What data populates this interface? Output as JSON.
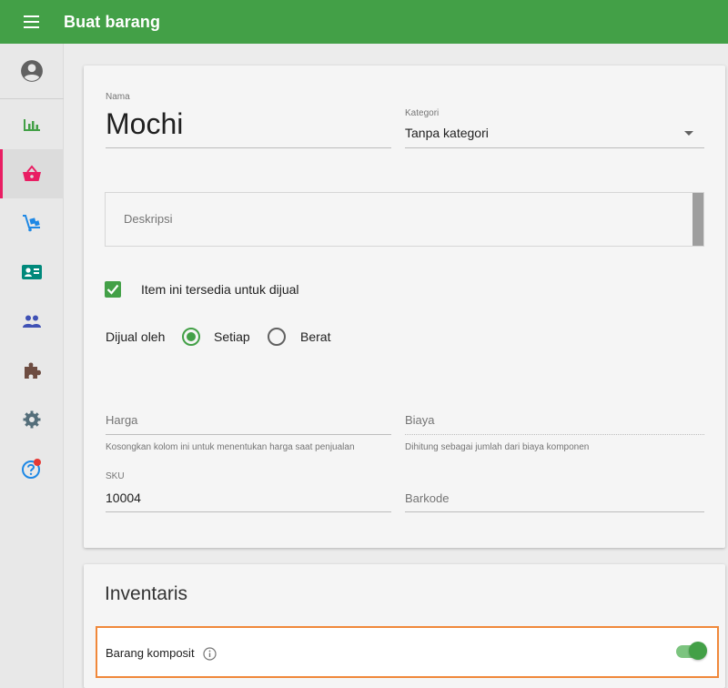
{
  "header": {
    "title": "Buat barang"
  },
  "sidebar": {
    "items": [
      {
        "icon": "account-circle-icon"
      },
      {
        "icon": "bar-chart-icon"
      },
      {
        "icon": "basket-icon",
        "active": true
      },
      {
        "icon": "cart-dolly-icon"
      },
      {
        "icon": "id-card-icon"
      },
      {
        "icon": "people-icon"
      },
      {
        "icon": "puzzle-icon"
      },
      {
        "icon": "gear-icon"
      },
      {
        "icon": "help-icon"
      }
    ]
  },
  "form": {
    "name_label": "Nama",
    "name_value": "Mochi",
    "category_label": "Kategori",
    "category_value": "Tanpa kategori",
    "description_placeholder": "Deskripsi",
    "available_label": "Item ini tersedia untuk dijual",
    "available_checked": true,
    "sold_by_label": "Dijual oleh",
    "sold_by_options": [
      "Setiap",
      "Berat"
    ],
    "sold_by_selected": "Setiap",
    "price_placeholder": "Harga",
    "price_hint": "Kosongkan kolom ini untuk menentukan harga saat penjualan",
    "cost_placeholder": "Biaya",
    "cost_hint": "Dihitung sebagai jumlah dari biaya komponen",
    "sku_label": "SKU",
    "sku_value": "10004",
    "barcode_placeholder": "Barkode"
  },
  "inventory": {
    "title": "Inventaris",
    "composite_label": "Barang komposit",
    "composite_enabled": true
  },
  "colors": {
    "primary": "#43a047",
    "active_indicator": "#e91e63",
    "highlight": "#f0883a"
  }
}
